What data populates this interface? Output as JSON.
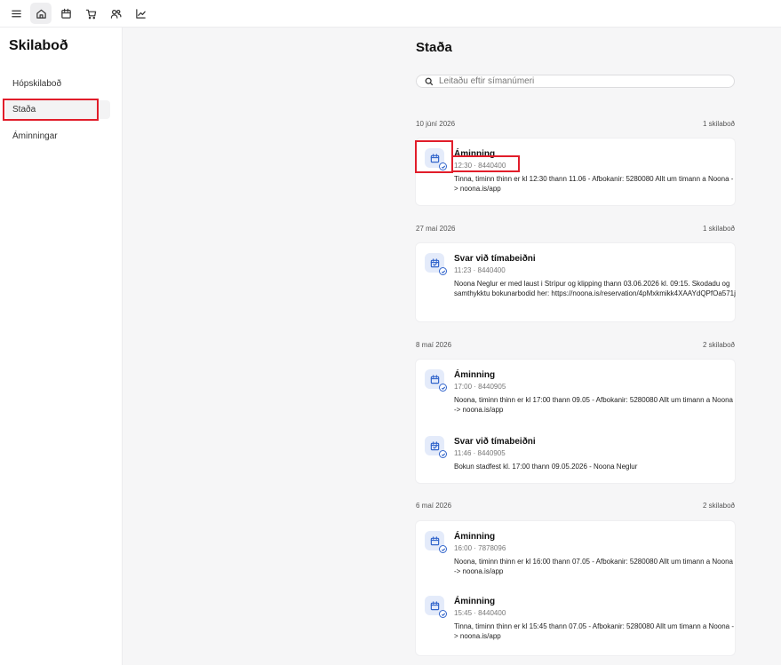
{
  "toolbar": {
    "icons": [
      "menu-icon",
      "home-icon",
      "calendar-icon",
      "cart-icon",
      "users-icon",
      "chart-icon"
    ]
  },
  "sidebar": {
    "title": "Skilaboð",
    "items": [
      {
        "label": "Hópskilaboð"
      },
      {
        "label": "Staða"
      },
      {
        "label": "Áminningar"
      }
    ]
  },
  "main": {
    "title": "Staða",
    "search": {
      "placeholder": "Leitaðu eftir símanúmeri",
      "value": ""
    },
    "groups": [
      {
        "date": "10 júní 2026",
        "count": "1 skilaboð",
        "messages": [
          {
            "title": "Áminning",
            "meta": "12:30 · 8440400",
            "body": "Tinna, timinn thinn er kl 12:30 thann 11.06 - Afbokanir: 5280080 Allt um timann a Noona -> noona.is/app"
          }
        ]
      },
      {
        "date": "27 maí 2026",
        "count": "1 skilaboð",
        "messages": [
          {
            "title": "Svar við tímabeiðni",
            "meta": "11:23 · 8440400",
            "body": "Noona Neglur er med laust i Strípur og klipping thann 03.06.2026 kl. 09:15. Skodadu og samthykktu bokunarbodid her: https://noona.is/reservation/4pMxkmikk4XAAYdQPfOa571j"
          }
        ]
      },
      {
        "date": "8 maí 2026",
        "count": "2 skilaboð",
        "messages": [
          {
            "title": "Áminning",
            "meta": "17:00 · 8440905",
            "body": "Noona, timinn thinn er kl 17:00 thann 09.05 - Afbokanir: 5280080 Allt um timann a Noona -> noona.is/app"
          },
          {
            "title": "Svar við tímabeiðni",
            "meta": "11:46 · 8440905",
            "body": "Bokun stadfest kl. 17:00 thann 09.05.2026 - Noona Neglur"
          }
        ]
      },
      {
        "date": "6 maí 2026",
        "count": "2 skilaboð",
        "messages": [
          {
            "title": "Áminning",
            "meta": "16:00 · 7878096",
            "body": "Noona, timinn thinn er kl 16:00 thann 07.05 - Afbokanir: 5280080 Allt um timann a Noona -> noona.is/app"
          },
          {
            "title": "Áminning",
            "meta": "15:45 · 8440400",
            "body": "Tinna, timinn thinn er kl 15:45 thann 07.05 - Afbokanir: 5280080 Allt um timann a Noona -> noona.is/app"
          }
        ]
      }
    ]
  },
  "colors": {
    "highlight": "#e11d2a",
    "accent": "#3366cc",
    "icon_bg": "#e4ebfa"
  }
}
